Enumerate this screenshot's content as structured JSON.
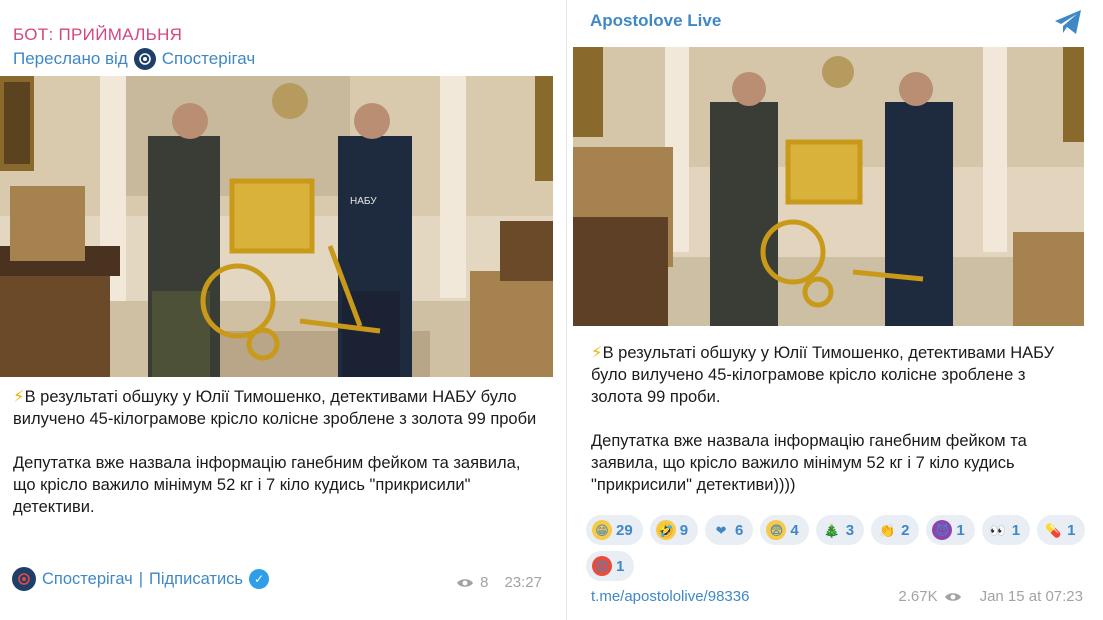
{
  "left_post": {
    "bot_title": "БОТ: ПРИЙМАЛЬНЯ",
    "forwarded_prefix": "Переслано від",
    "forwarded_channel": "Спостерігач",
    "message_paragraph_1": "В результаті обшуку у Юлії Тимошенко, детективами НАБУ було вилучено 45-кілограмове крісло колісне зроблене з золота 99 проби",
    "message_paragraph_2": "Депутатка вже назвала інформацію ганебним фейком та заявила, що крісло важило мінімум 52 кг і 7 кіло кудись \"прикрисили\" детективи.",
    "footer_channel": "Спостерігач",
    "footer_separator": "|",
    "footer_subscribe": "Підписатись",
    "views": "8",
    "time": "23:27",
    "photo_vest_label": "НАБУ"
  },
  "right_post": {
    "channel_name": "Apostolove Live",
    "message_paragraph_1": "В результаті обшуку у Юлії Тимошенко, детективами НАБУ було вилучено 45-кілограмове крісло колісне зроблене з золота 99 проби.",
    "message_paragraph_2": "Депутатка вже назвала інформацію ганебним фейком та заявила, що крісло важило мінімум 52 кг і 7 кіло кудись \"прикрисили\" детективи))))",
    "reactions": [
      {
        "emoji": "😁",
        "count": "29",
        "bg": "#f7c948"
      },
      {
        "emoji": "🤣",
        "count": "9",
        "bg": "#f7c948"
      },
      {
        "emoji": "❤",
        "count": "6",
        "bg": "transparent"
      },
      {
        "emoji": "😨",
        "count": "4",
        "bg": "#f7c948"
      },
      {
        "emoji": "🎄",
        "count": "3",
        "bg": "transparent"
      },
      {
        "emoji": "👏",
        "count": "2",
        "bg": "transparent"
      },
      {
        "emoji": "😈",
        "count": "1",
        "bg": "#8e44ad"
      },
      {
        "emoji": "👀",
        "count": "1",
        "bg": "transparent"
      },
      {
        "emoji": "💊",
        "count": "1",
        "bg": "transparent"
      },
      {
        "emoji": "😡",
        "count": "1",
        "bg": "#e74c3c"
      }
    ],
    "post_link": "t.me/apostololive/98336",
    "views": "2.67K",
    "time": "Jan 15 at 07:23"
  },
  "colors": {
    "link_blue": "#3f88c5",
    "bot_pink": "#d6457f",
    "meta_gray": "#a3a3a3",
    "gold": "#d8b23a"
  },
  "icons": {
    "lightning": "high-voltage-icon",
    "telegram": "telegram-logo-icon",
    "views": "eye-icon",
    "verified": "verified-checkmark-icon"
  }
}
